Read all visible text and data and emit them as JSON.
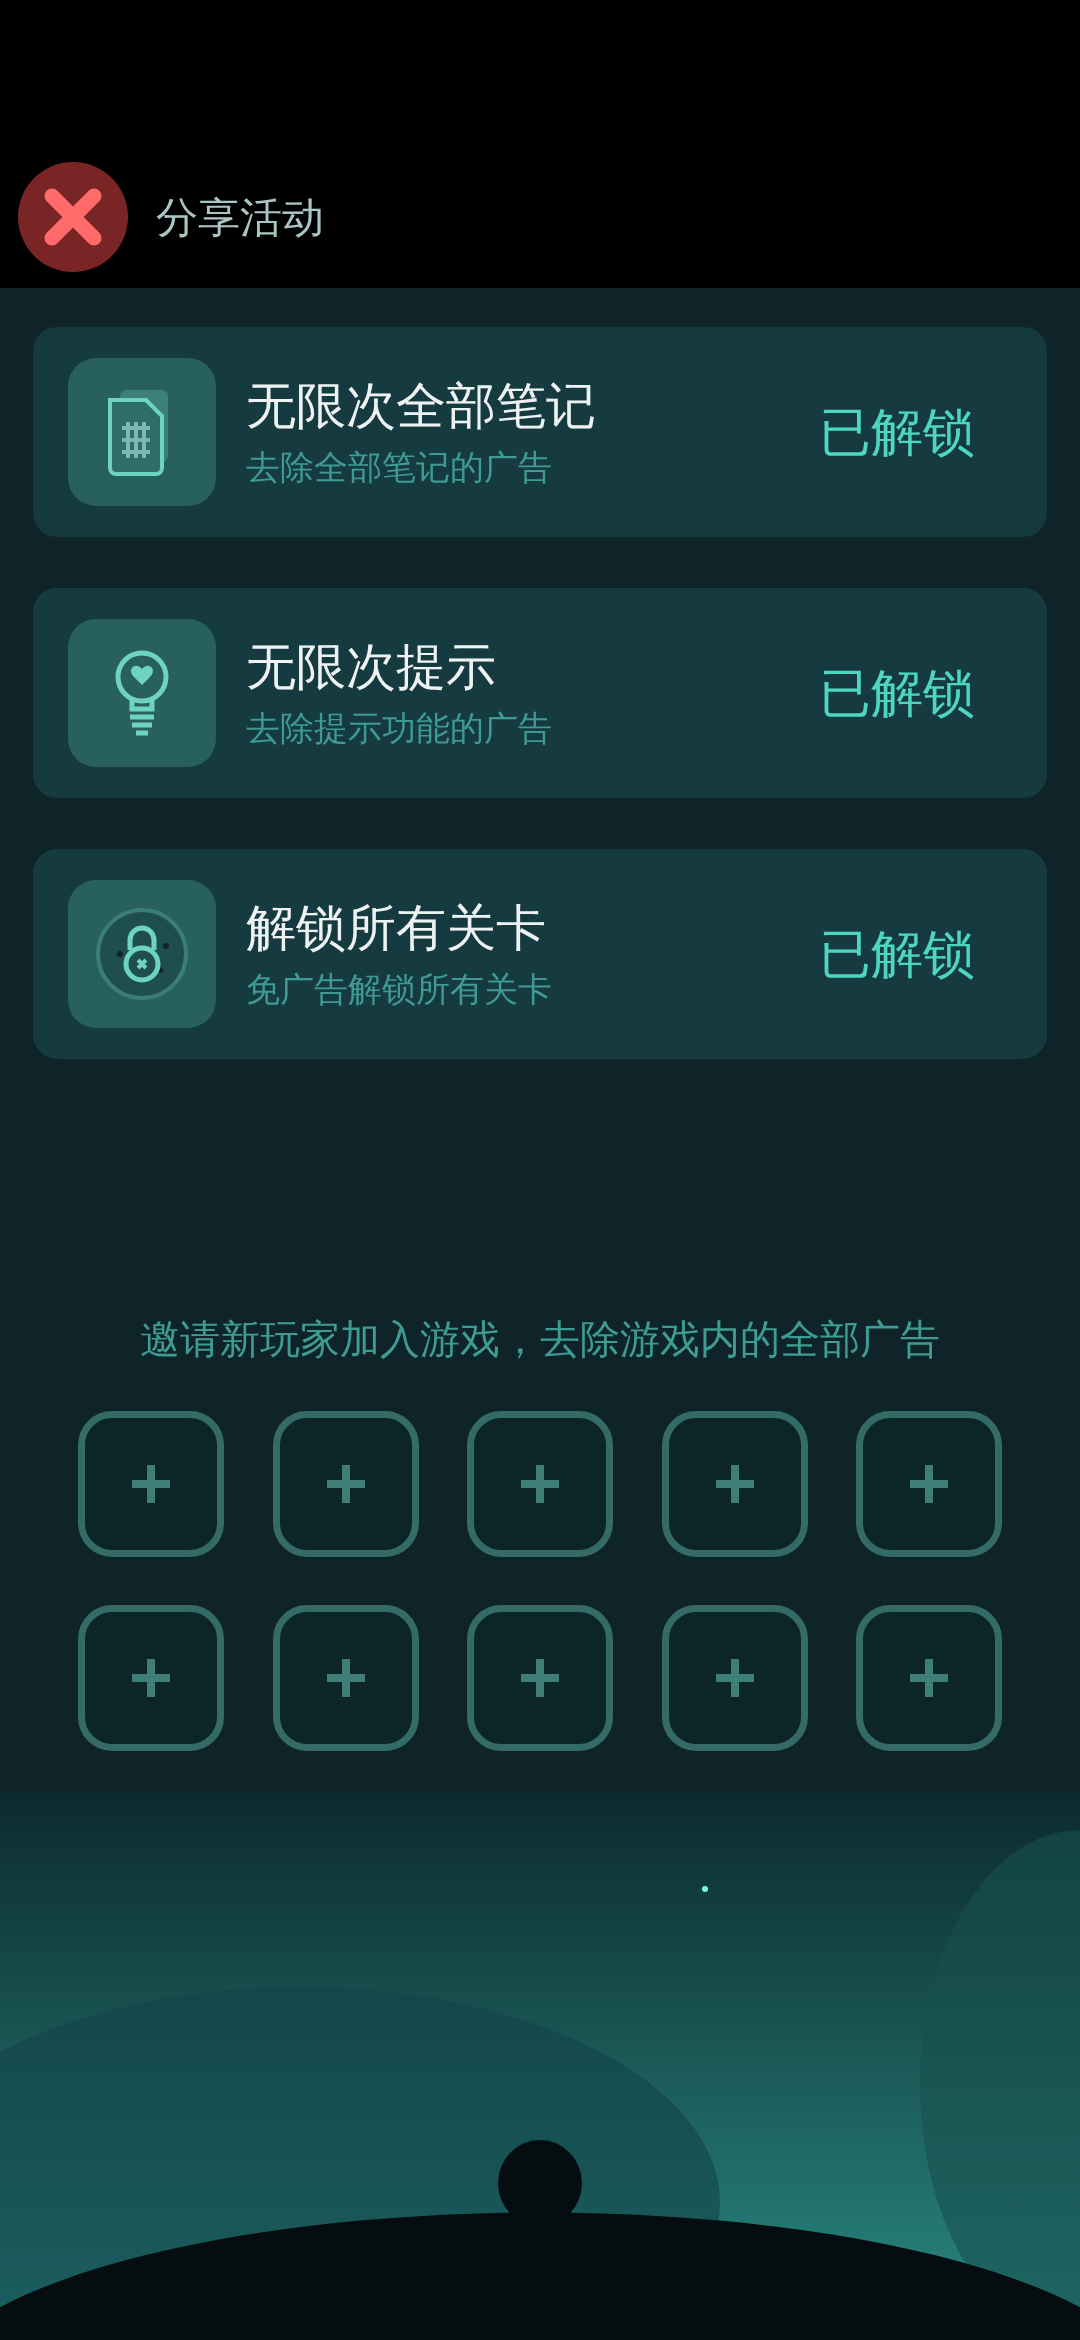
{
  "header": {
    "title": "分享活动"
  },
  "perks": [
    {
      "kind": "notes",
      "title": "无限次全部笔记",
      "subtitle": "去除全部笔记的广告",
      "status": "已解锁"
    },
    {
      "kind": "hint",
      "title": "无限次提示",
      "subtitle": "去除提示功能的广告",
      "status": "已解锁"
    },
    {
      "kind": "levels",
      "title": "解锁所有关卡",
      "subtitle": "免广告解锁所有关卡",
      "status": "已解锁"
    }
  ],
  "invite": {
    "text": "邀请新玩家加入游戏，去除游戏内的全部广告",
    "slots": [
      {
        "kind": "empty"
      },
      {
        "kind": "empty"
      },
      {
        "kind": "empty"
      },
      {
        "kind": "empty"
      },
      {
        "kind": "empty"
      },
      {
        "kind": "empty"
      },
      {
        "kind": "empty"
      },
      {
        "kind": "empty"
      },
      {
        "kind": "empty"
      },
      {
        "kind": "empty"
      }
    ]
  }
}
